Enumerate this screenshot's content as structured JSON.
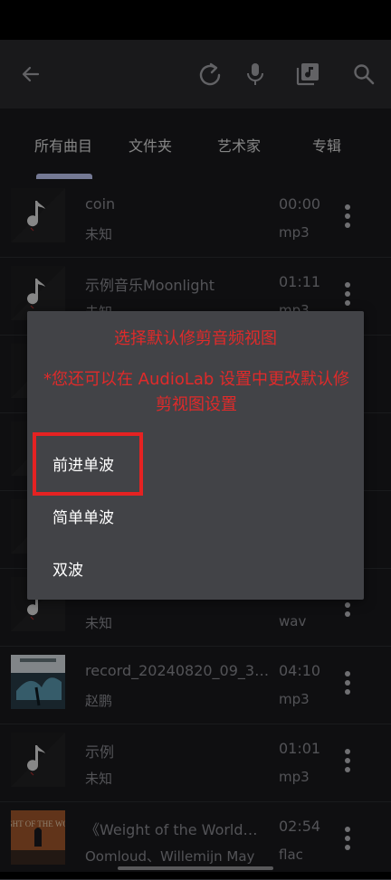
{
  "toolbar": {
    "icons": [
      "back-arrow-icon",
      "refresh-icon",
      "microphone-icon",
      "music-library-icon",
      "search-icon"
    ]
  },
  "tabs": [
    {
      "label": "所有曲目",
      "active": true
    },
    {
      "label": "文件夹",
      "active": false
    },
    {
      "label": "艺术家",
      "active": false
    },
    {
      "label": "专辑",
      "active": false
    }
  ],
  "tracks": [
    {
      "title": "coin",
      "artist": "未知",
      "duration": "00:00",
      "format": "mp3",
      "art": "default"
    },
    {
      "title": "示例音乐Moonlight",
      "artist": "未知",
      "duration": "01:11",
      "format": "mp3",
      "art": "default"
    },
    {
      "title": "",
      "artist": "",
      "duration": "",
      "format": "",
      "art": "default"
    },
    {
      "title": "",
      "artist": "",
      "duration": "",
      "format": "",
      "art": "default"
    },
    {
      "title": "",
      "artist": "",
      "duration": "",
      "format": "",
      "art": "default"
    },
    {
      "title": "",
      "artist": "未知",
      "duration": "",
      "format": "wav",
      "art": "default"
    },
    {
      "title": "record_20240820_09_38…",
      "artist": "赵鹏",
      "duration": "04:10",
      "format": "mp3",
      "art": "photo"
    },
    {
      "title": "示例",
      "artist": "未知",
      "duration": "01:01",
      "format": "mp3",
      "art": "default"
    },
    {
      "title": "《Weight of the World》…",
      "artist": "Oomloud、Willemijn May",
      "duration": "02:54",
      "format": "flac",
      "art": "cover"
    }
  ],
  "dialog": {
    "title": "选择默认修剪音频视图",
    "note": "*您还可以在 AudioLab 设置中更改默认修剪视图设置",
    "options": [
      "前进单波",
      "简单单波",
      "双波"
    ],
    "highlighted_option": 0
  },
  "colors": {
    "accent": "#c9d0ff",
    "warning": "#e02a2a",
    "highlight": "#e52222"
  },
  "album_cover_text": "WEIGHT OF THE WORLD"
}
